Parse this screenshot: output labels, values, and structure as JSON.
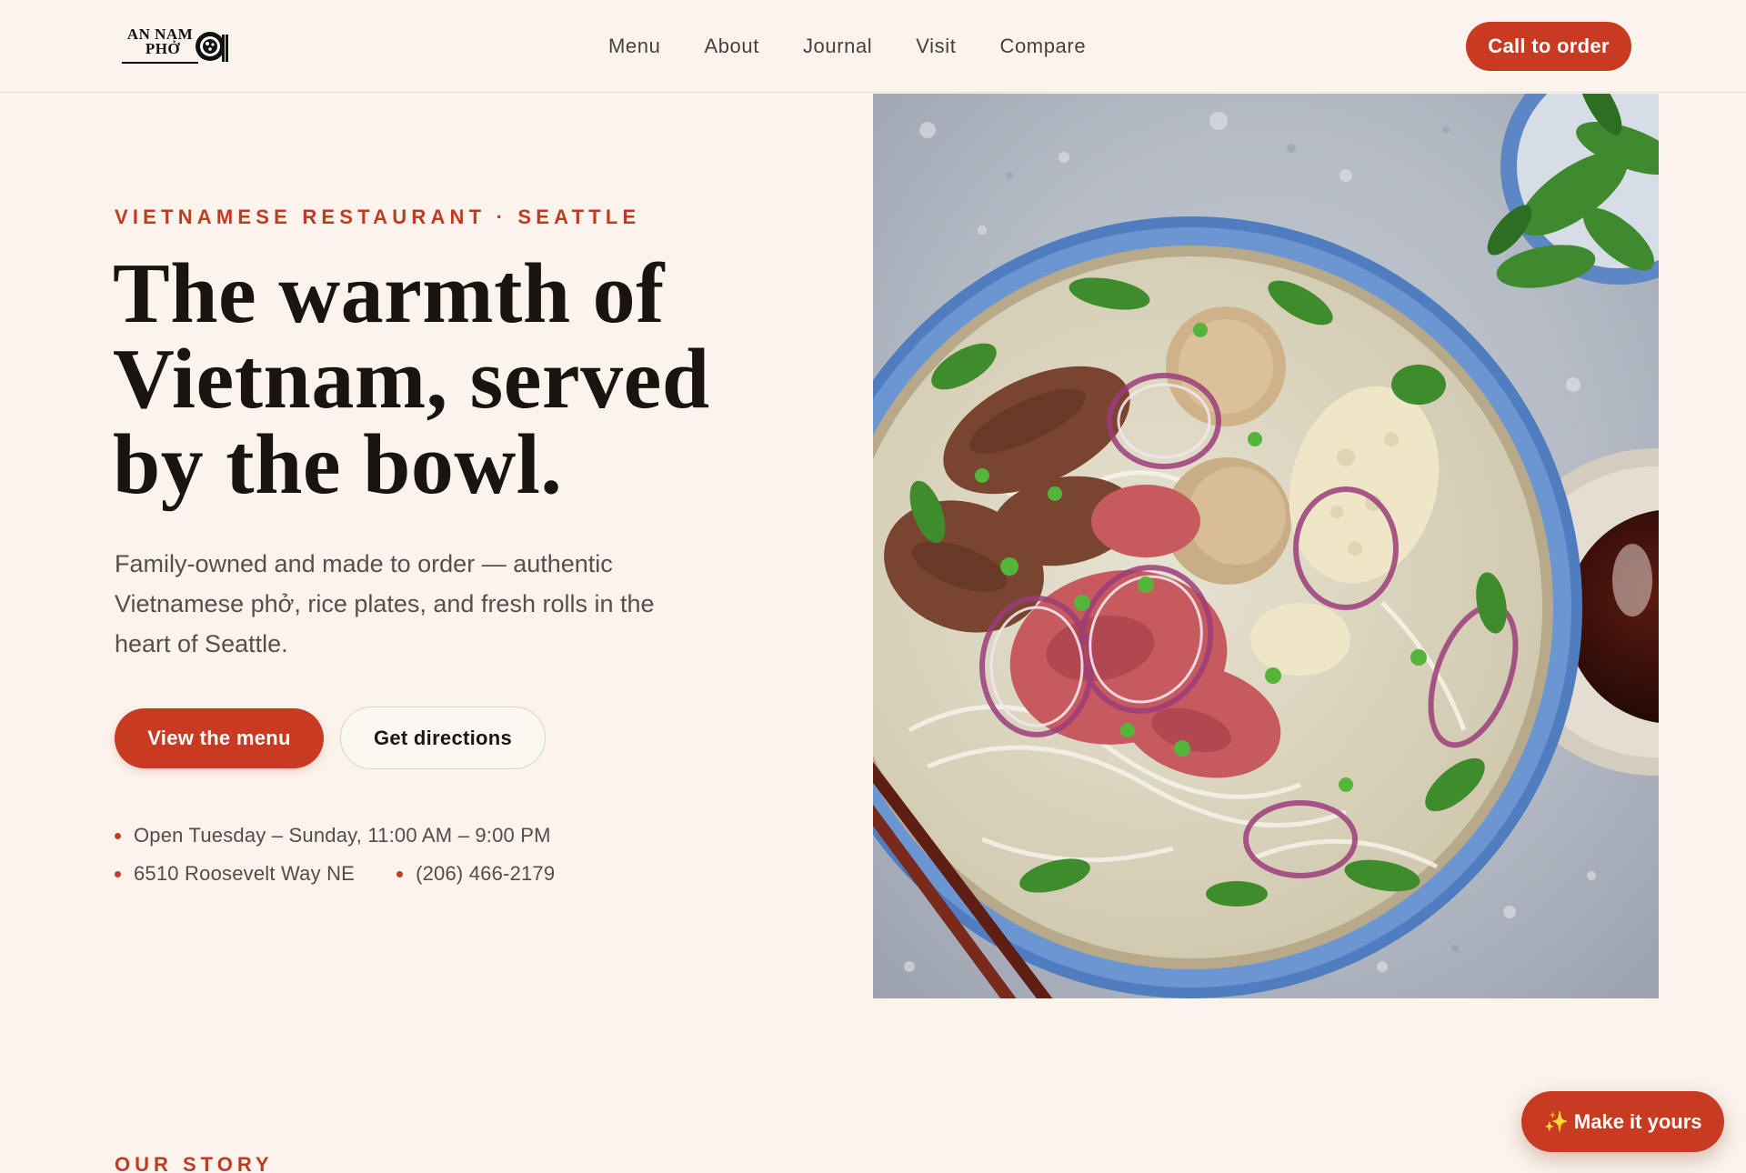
{
  "brand": {
    "logo_line1": "AN NAM",
    "logo_line2": "PHỞ"
  },
  "nav": {
    "items": [
      "Menu",
      "About",
      "Journal",
      "Visit",
      "Compare"
    ]
  },
  "header": {
    "cta_label": "Call to order"
  },
  "hero": {
    "eyebrow": "VIETNAMESE RESTAURANT · SEATTLE",
    "title_lines": [
      "The warmth of",
      "Vietnam, served",
      "by the bowl."
    ],
    "description_lines": [
      "Family-owned and made to order — authentic",
      "Vietnamese phở, rice plates, and fresh rolls in the",
      "heart of Seattle."
    ],
    "primary_button": "View the menu",
    "secondary_button": "Get directions",
    "hours": "Open Tuesday – Sunday, 11:00 AM – 9:00 PM",
    "address": "6510 Roosevelt Way NE",
    "phone": "(206) 466-2179",
    "image_icon": "pho-bowl-photo"
  },
  "story": {
    "label": "OUR STORY"
  },
  "floating": {
    "icon": "sparkles-icon",
    "label": "Make it yours"
  },
  "colors": {
    "accent": "#c93a22",
    "background": "#faf4ec",
    "text": "#1c1511"
  }
}
